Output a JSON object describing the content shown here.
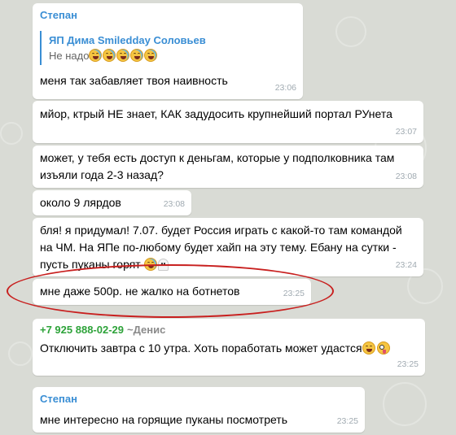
{
  "messages": [
    {
      "sender": "Степан",
      "reply_author": "ЯП Дима Smiledday Соловьев",
      "reply_text": "Не надо",
      "reply_emoji_count": 5,
      "text": "меня так забавляет твоя наивность",
      "time": "23:06"
    },
    {
      "text": "мйор, ктрый НЕ знает, КАК задудосить крупнейший портал РУнета",
      "time": "23:07"
    },
    {
      "text": "может, у тебя есть доступ к деньгам, которые у подполковника там\nизъяли года 2-3 назад?",
      "time": "23:08"
    },
    {
      "text": "около 9 лярдов",
      "time": "23:08"
    },
    {
      "text": "бля! я придумал! 7.07. будет Россия играть с какой-то там командой\nна ЧМ. На ЯПе по-любому будет хайп на эту тему. Ебану на сутки -\nпусть пуканы горят",
      "time": "23:24",
      "emojis": [
        "laughing-emoji",
        "ghost-emoji"
      ]
    },
    {
      "text": "мне даже 500р. не жалко на ботнетов",
      "time": "23:25",
      "highlighted": true
    },
    {
      "sender_phone": "+7 925 888-02-29",
      "forwarded_from": "~Денис",
      "text": "Отключить завтра с 10 утра. Хоть поработать может удастся",
      "time": "23:25",
      "emojis": [
        "crazy-face-emoji",
        "tongue-wink-emoji"
      ]
    },
    {
      "sender": "Степан",
      "text": "мне интересно на горящие пуканы посмотреть",
      "time": "23:25"
    }
  ],
  "colors": {
    "sender": "#3a8ed4",
    "phone_sender": "#2ea33a",
    "highlight_ring": "#c8201f",
    "wallpaper": "#d9dbd5"
  }
}
